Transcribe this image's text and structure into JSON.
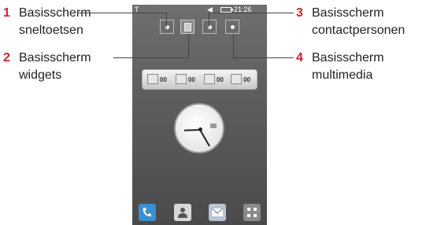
{
  "callouts": [
    {
      "number": "1",
      "line1": "Basisscherm",
      "line2": "sneltoetsen"
    },
    {
      "number": "2",
      "line1": "Basisscherm",
      "line2": "widgets"
    },
    {
      "number": "3",
      "line1": "Basisscherm",
      "line2": "contactpersonen"
    },
    {
      "number": "4",
      "line1": "Basisscherm",
      "line2": "multimedia"
    }
  ],
  "status_bar": {
    "time": "21:26"
  },
  "notifications": [
    {
      "icon": "call-log-icon",
      "count": "00"
    },
    {
      "icon": "message-icon",
      "count": "00"
    },
    {
      "icon": "voicemail-icon",
      "count": "00"
    },
    {
      "icon": "email-icon",
      "count": "00"
    }
  ],
  "dock": [
    {
      "icon": "phone-icon"
    },
    {
      "icon": "contacts-icon"
    },
    {
      "icon": "messaging-icon"
    },
    {
      "icon": "menu-icon"
    }
  ],
  "colors": {
    "callout_number": "#c4262e",
    "dock_phone": "#3a8fd0"
  }
}
